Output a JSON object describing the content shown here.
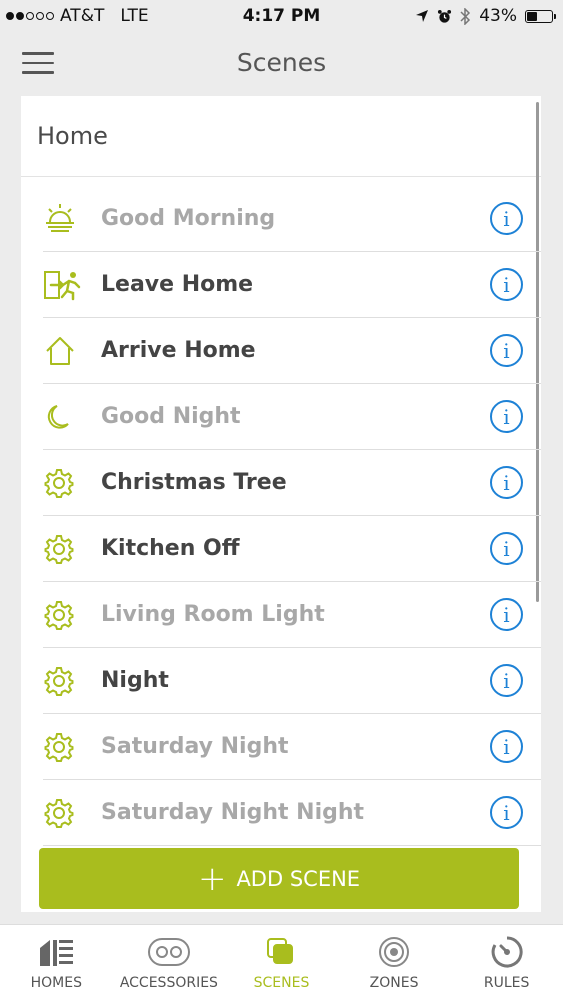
{
  "status_bar": {
    "carrier": "AT&T",
    "network": "LTE",
    "time": "4:17 PM",
    "battery_percent": "43%",
    "battery_level": 0.43
  },
  "nav": {
    "title": "Scenes"
  },
  "home": {
    "title": "Home"
  },
  "scenes": [
    {
      "name": "Good Morning",
      "icon": "sunrise-icon",
      "active": false
    },
    {
      "name": "Leave Home",
      "icon": "leave-home-icon",
      "active": true
    },
    {
      "name": "Arrive Home",
      "icon": "house-icon",
      "active": true
    },
    {
      "name": "Good Night",
      "icon": "moon-icon",
      "active": false
    },
    {
      "name": "Christmas Tree",
      "icon": "gear-icon",
      "active": true
    },
    {
      "name": "Kitchen Off",
      "icon": "gear-icon",
      "active": true
    },
    {
      "name": "Living Room Light",
      "icon": "gear-icon",
      "active": false
    },
    {
      "name": "Night",
      "icon": "gear-icon",
      "active": true
    },
    {
      "name": "Saturday Night",
      "icon": "gear-icon",
      "active": false
    },
    {
      "name": "Saturday Night Night",
      "icon": "gear-icon",
      "active": false
    }
  ],
  "add_scene": {
    "label": "ADD SCENE"
  },
  "tabs": [
    {
      "label": "HOMES",
      "icon": "homes-icon",
      "active": false
    },
    {
      "label": "ACCESSORIES",
      "icon": "accessories-icon",
      "active": false
    },
    {
      "label": "SCENES",
      "icon": "scenes-icon",
      "active": true
    },
    {
      "label": "ZONES",
      "icon": "zones-icon",
      "active": false
    },
    {
      "label": "RULES",
      "icon": "rules-icon",
      "active": false
    }
  ],
  "colors": {
    "accent": "#a9bd1e",
    "info": "#1e82d6",
    "dim_text": "#a8a8a8",
    "dark_text": "#444444"
  }
}
